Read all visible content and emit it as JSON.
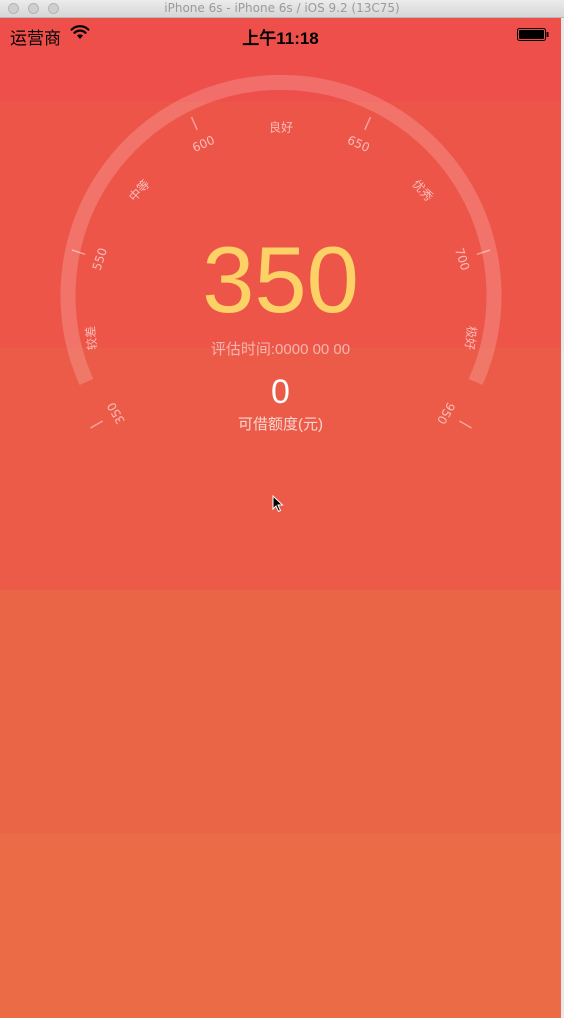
{
  "window": {
    "title": "iPhone 6s - iPhone 6s / iOS 9.2 (13C75)"
  },
  "status_bar": {
    "carrier": "运营商",
    "time": "上午11:18"
  },
  "gauge": {
    "scale_labels": [
      "350",
      "较差",
      "550",
      "中等",
      "600",
      "良好",
      "650",
      "优秀",
      "700",
      "极好",
      "950"
    ],
    "score": "350",
    "eval_time": "评估时间:0000 00 00",
    "amount": "0",
    "amount_label": "可借额度(元)"
  },
  "colors": {
    "background_top": "#ee4e48",
    "background_bottom": "#eb6b47",
    "score": "#fcd267"
  },
  "icons": [
    "wifi-icon",
    "battery-icon",
    "mouse-cursor-icon"
  ]
}
